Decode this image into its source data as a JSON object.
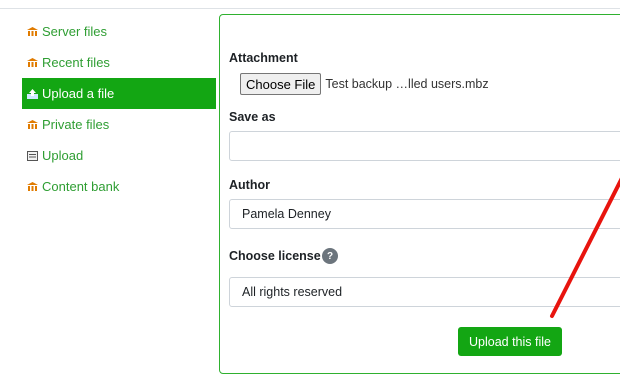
{
  "sidebar": {
    "items": [
      {
        "label": "Server files",
        "icon": "repository-icon"
      },
      {
        "label": "Recent files",
        "icon": "repository-icon"
      },
      {
        "label": "Upload a file",
        "icon": "upload-icon",
        "active": true
      },
      {
        "label": "Private files",
        "icon": "repository-icon"
      },
      {
        "label": "Upload",
        "icon": "upload-box-icon"
      },
      {
        "label": "Content bank",
        "icon": "repository-icon"
      }
    ]
  },
  "form": {
    "attachment_label": "Attachment",
    "choose_file_label": "Choose File",
    "file_name": "Test backup …lled users.mbz",
    "save_as_label": "Save as",
    "save_as_value": "",
    "author_label": "Author",
    "author_value": "Pamela Denney",
    "license_label": "Choose license",
    "license_help": "?",
    "license_value": "All rights reserved",
    "submit_label": "Upload this file"
  },
  "colors": {
    "accent": "#13a613",
    "link": "#2f9e33",
    "annotation": "#e8140e"
  }
}
